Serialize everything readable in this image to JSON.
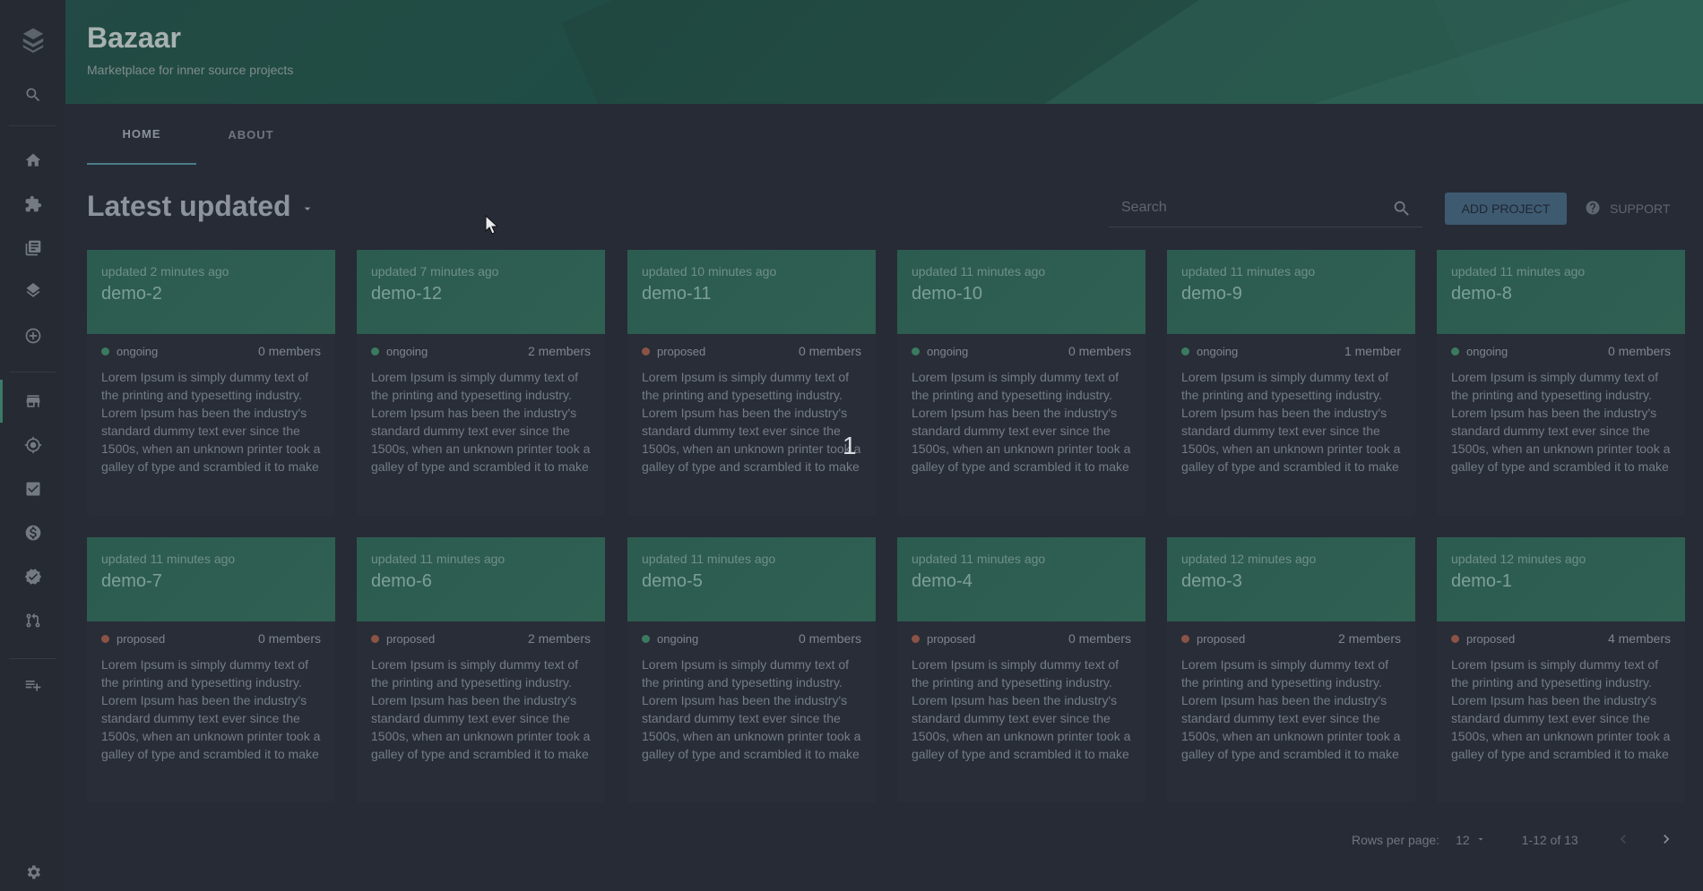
{
  "app": {
    "title": "Bazaar",
    "subtitle": "Marketplace for inner source projects"
  },
  "tabs": [
    {
      "label": "HOME",
      "active": true
    },
    {
      "label": "ABOUT",
      "active": false
    }
  ],
  "toolbar": {
    "section_title": "Latest updated",
    "search_placeholder": "Search",
    "add_label": "ADD PROJECT",
    "support_label": "SUPPORT"
  },
  "sidebar": {
    "icons": [
      "logo-icon",
      "search-icon",
      "home-icon",
      "puzzle-icon",
      "library-icon",
      "layers-icon",
      "add-circle-icon",
      "store-icon",
      "target-icon",
      "check-box-icon",
      "dollar-icon",
      "settings-badge-icon",
      "pull-request-icon",
      "playlist-add-icon",
      "gear-icon"
    ],
    "active": "store-icon"
  },
  "colors": {
    "accent": "#2c5b50",
    "ongoing": "#3b7a60",
    "proposed": "#8a5345"
  },
  "projects": [
    {
      "updated": "updated 2 minutes ago",
      "name": "demo-2",
      "status": "ongoing",
      "members": "0 members",
      "description": "Lorem Ipsum is simply dummy text of the printing and typesetting industry. Lorem Ipsum has been the industry's standard dummy text ever since the 1500s, when an unknown printer took a galley of type and scrambled it to make a type specimen book. It has…"
    },
    {
      "updated": "updated 7 minutes ago",
      "name": "demo-12",
      "status": "ongoing",
      "members": "2 members",
      "description": "Lorem Ipsum is simply dummy text of the printing and typesetting industry. Lorem Ipsum has been the industry's standard dummy text ever since the 1500s, when an unknown printer took a galley of type and scrambled it to make a type specimen book. It has…"
    },
    {
      "updated": "updated 10 minutes ago",
      "name": "demo-11",
      "status": "proposed",
      "members": "0 members",
      "description": "Lorem Ipsum is simply dummy text of the printing and typesetting industry. Lorem Ipsum has been the industry's standard dummy text ever since the 1500s, when an unknown printer took a galley of type and scrambled it to make a type specimen book. It has…"
    },
    {
      "updated": "updated 11 minutes ago",
      "name": "demo-10",
      "status": "ongoing",
      "members": "0 members",
      "description": "Lorem Ipsum is simply dummy text of the printing and typesetting industry. Lorem Ipsum has been the industry's standard dummy text ever since the 1500s, when an unknown printer took a galley of type and scrambled it to make a type specimen book. It has…"
    },
    {
      "updated": "updated 11 minutes ago",
      "name": "demo-9",
      "status": "ongoing",
      "members": "1 member",
      "description": "Lorem Ipsum is simply dummy text of the printing and typesetting industry. Lorem Ipsum has been the industry's standard dummy text ever since the 1500s, when an unknown printer took a galley of type and scrambled it to make a type specimen book. It has…"
    },
    {
      "updated": "updated 11 minutes ago",
      "name": "demo-8",
      "status": "ongoing",
      "members": "0 members",
      "description": "Lorem Ipsum is simply dummy text of the printing and typesetting industry. Lorem Ipsum has been the industry's standard dummy text ever since the 1500s, when an unknown printer took a galley of type and scrambled it to make a type specimen book. It has…"
    },
    {
      "updated": "updated 11 minutes ago",
      "name": "demo-7",
      "status": "proposed",
      "members": "0 members",
      "description": "Lorem Ipsum is simply dummy text of the printing and typesetting industry. Lorem Ipsum has been the industry's standard dummy text ever since the 1500s, when an unknown printer took a galley of type and scrambled it to make a type specimen book. It has…"
    },
    {
      "updated": "updated 11 minutes ago",
      "name": "demo-6",
      "status": "proposed",
      "members": "2 members",
      "description": "Lorem Ipsum is simply dummy text of the printing and typesetting industry. Lorem Ipsum has been the industry's standard dummy text ever since the 1500s, when an unknown printer took a galley of type and scrambled it to make a type specimen book. It has…"
    },
    {
      "updated": "updated 11 minutes ago",
      "name": "demo-5",
      "status": "ongoing",
      "members": "0 members",
      "description": "Lorem Ipsum is simply dummy text of the printing and typesetting industry. Lorem Ipsum has been the industry's standard dummy text ever since the 1500s, when an unknown printer took a galley of type and scrambled it to make a type specimen book. It has…"
    },
    {
      "updated": "updated 11 minutes ago",
      "name": "demo-4",
      "status": "proposed",
      "members": "0 members",
      "description": "Lorem Ipsum is simply dummy text of the printing and typesetting industry. Lorem Ipsum has been the industry's standard dummy text ever since the 1500s, when an unknown printer took a galley of type and scrambled it to make a type specimen book. It has…"
    },
    {
      "updated": "updated 12 minutes ago",
      "name": "demo-3",
      "status": "proposed",
      "members": "2 members",
      "description": "Lorem Ipsum is simply dummy text of the printing and typesetting industry. Lorem Ipsum has been the industry's standard dummy text ever since the 1500s, when an unknown printer took a galley of type and scrambled it to make a type specimen book. It has…"
    },
    {
      "updated": "updated 12 minutes ago",
      "name": "demo-1",
      "status": "proposed",
      "members": "4 members",
      "description": "Lorem Ipsum is simply dummy text of the printing and typesetting industry. Lorem Ipsum has been the industry's standard dummy text ever since the 1500s, when an unknown printer took a galley of type and scrambled it to make a type specimen book. It has…"
    }
  ],
  "pagination": {
    "rows_label": "Rows per page:",
    "rows_value": "12",
    "range": "1-12 of 13"
  },
  "overlay_number": "1"
}
